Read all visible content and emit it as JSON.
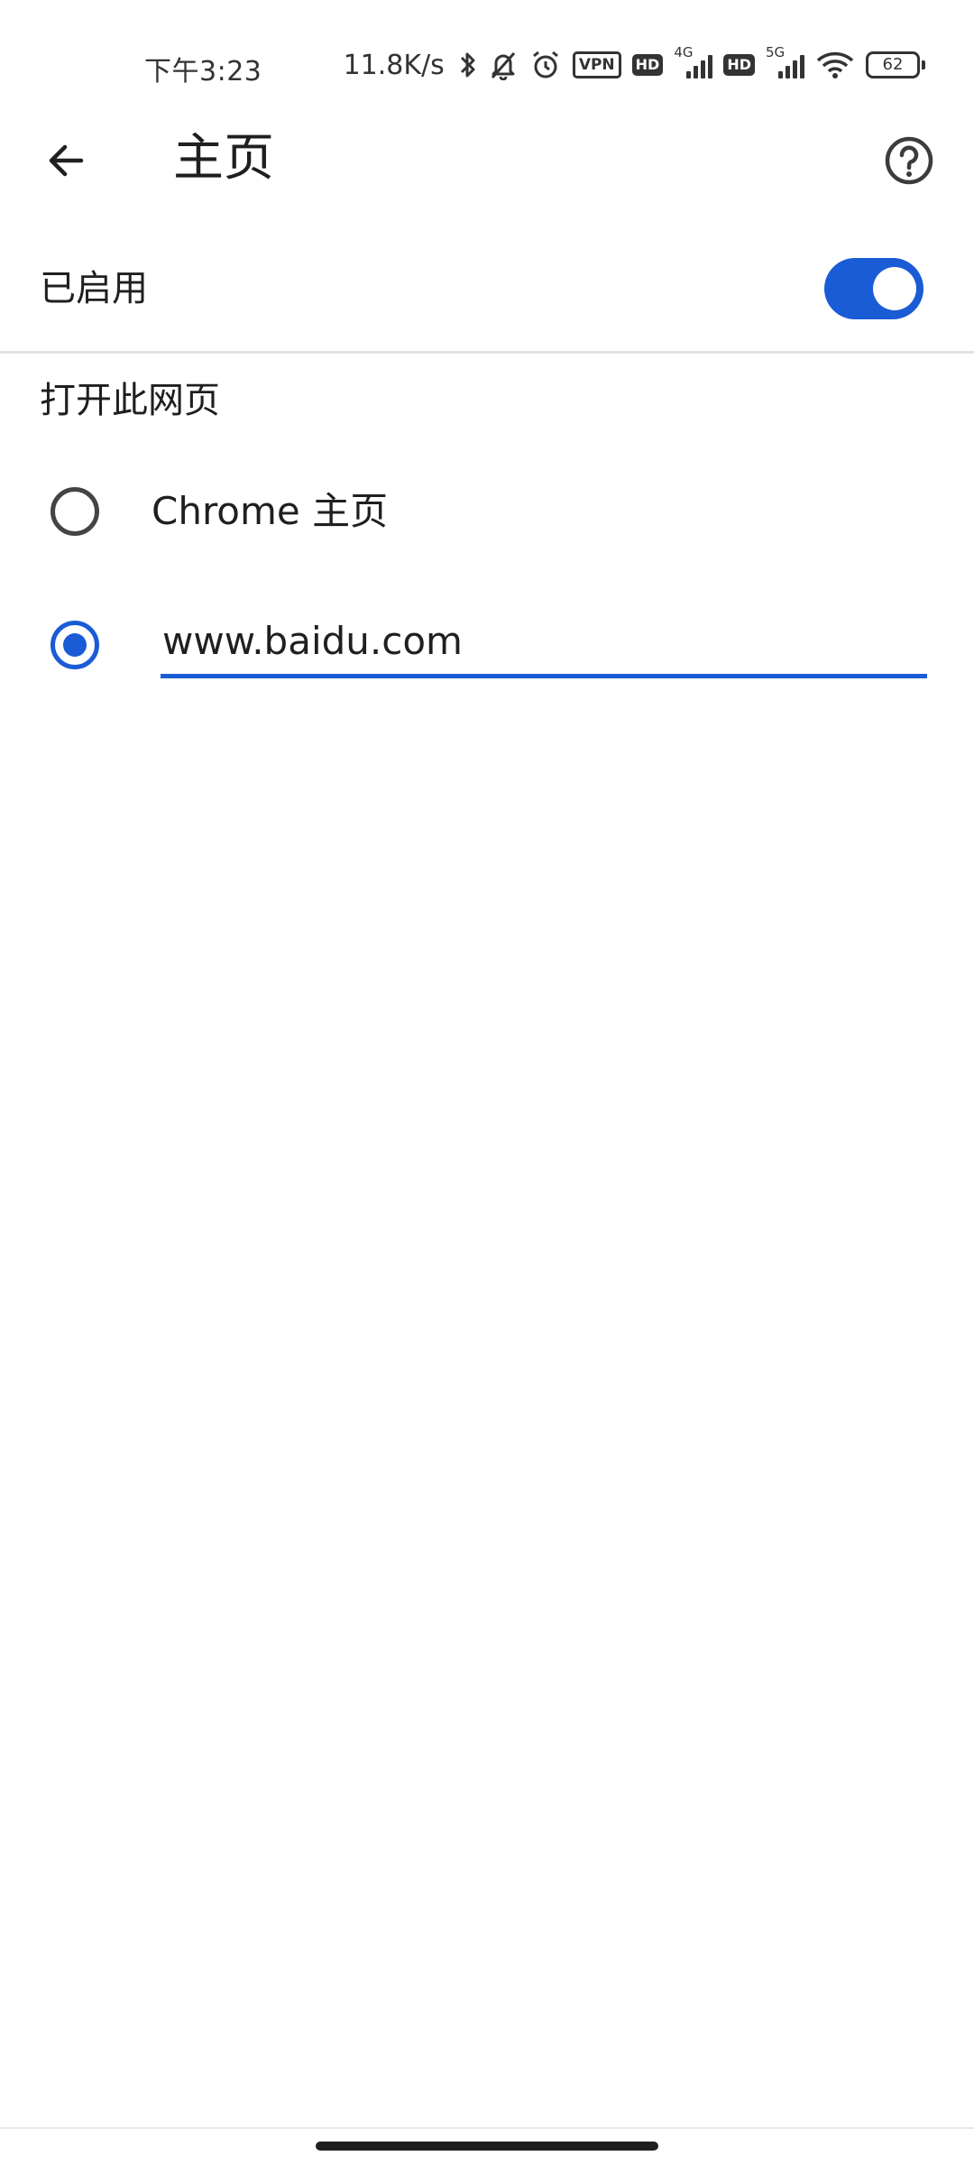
{
  "status_bar": {
    "time": "下午3:23",
    "net_speed": "11.8K/s",
    "vpn_label": "VPN",
    "hd_label_1": "HD",
    "network_1": "4G",
    "hd_label_2": "HD",
    "network_2": "5G",
    "battery": "62",
    "icons": [
      "bluetooth-icon",
      "bell-off-icon",
      "alarm-icon",
      "vpn-icon",
      "hd-icon",
      "signal-icon",
      "wifi-icon",
      "battery-icon"
    ]
  },
  "app_bar": {
    "title": "主页",
    "back_icon": "arrow-left-icon",
    "help_icon": "help-circle-icon"
  },
  "enabled_row": {
    "label": "已启用",
    "toggle_on": true
  },
  "section": {
    "header": "打开此网页"
  },
  "options": {
    "chrome_home_label": "Chrome 主页",
    "chrome_home_selected": false,
    "custom_selected": true,
    "custom_url": "www.baidu.com"
  },
  "colors": {
    "accent": "#1a5bd6",
    "text": "#1f1f1f",
    "divider": "#e2e2e2"
  }
}
